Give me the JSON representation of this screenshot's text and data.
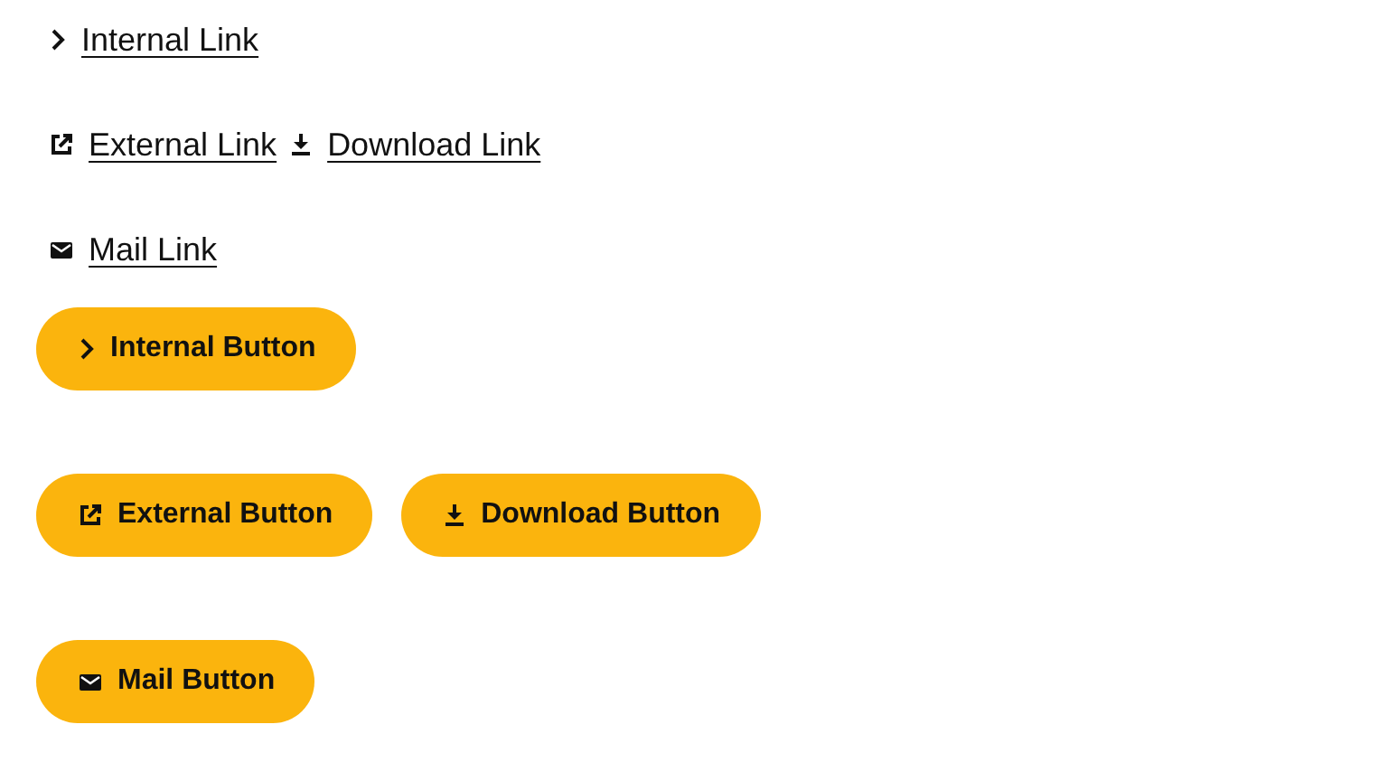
{
  "link_rows": [
    {
      "links": [
        {
          "kind": "internal",
          "label": "Internal Link"
        }
      ]
    },
    {
      "links": [
        {
          "kind": "external",
          "label": "External Link"
        },
        {
          "kind": "download",
          "label": "Download Link"
        }
      ]
    },
    {
      "links": [
        {
          "kind": "mail",
          "label": "Mail Link"
        }
      ]
    }
  ],
  "button_rows": [
    {
      "buttons": [
        {
          "kind": "internal",
          "label": "Internal Button"
        }
      ]
    },
    {
      "buttons": [
        {
          "kind": "external",
          "label": "External Button"
        },
        {
          "kind": "download",
          "label": "Download Button"
        }
      ]
    },
    {
      "buttons": [
        {
          "kind": "mail",
          "label": "Mail Button"
        }
      ]
    }
  ]
}
